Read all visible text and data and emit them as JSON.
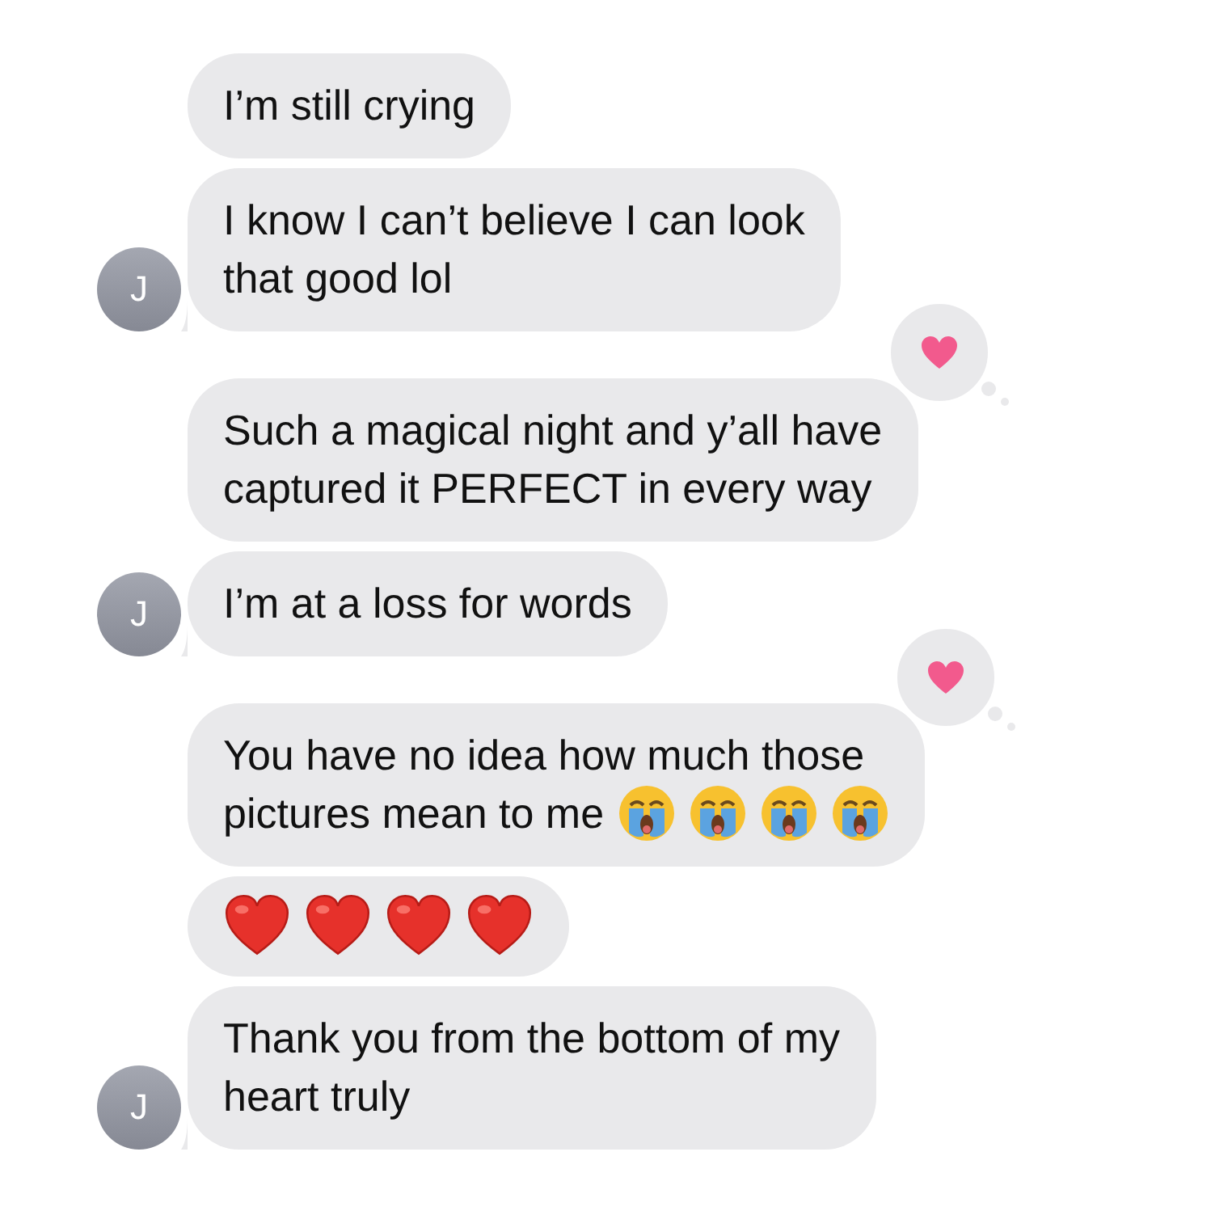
{
  "messages": [
    {
      "lines": [
        "I’m still crying"
      ]
    },
    {
      "lines": [
        "I know I can’t believe I can look",
        "that good lol"
      ],
      "avatar": "J"
    },
    {
      "lines": [
        "Such a magical night and y’all have",
        "captured it PERFECT in every way"
      ],
      "reaction": {
        "kind": "heart"
      }
    },
    {
      "lines": [
        "I’m at a loss for words"
      ],
      "avatar": "J"
    },
    {
      "lines": [
        "You have no idea how much those",
        "pictures mean to me"
      ],
      "reaction": {
        "kind": "heart"
      },
      "emojis": [
        {
          "kind": "crying"
        },
        {
          "kind": "crying"
        },
        {
          "kind": "crying"
        },
        {
          "kind": "crying"
        }
      ]
    },
    {
      "emojis": [
        {
          "kind": "heart"
        },
        {
          "kind": "heart"
        },
        {
          "kind": "heart"
        },
        {
          "kind": "heart"
        }
      ]
    },
    {
      "lines": [
        "Thank you from the bottom of my",
        "heart truly"
      ],
      "avatar": "J"
    }
  ]
}
